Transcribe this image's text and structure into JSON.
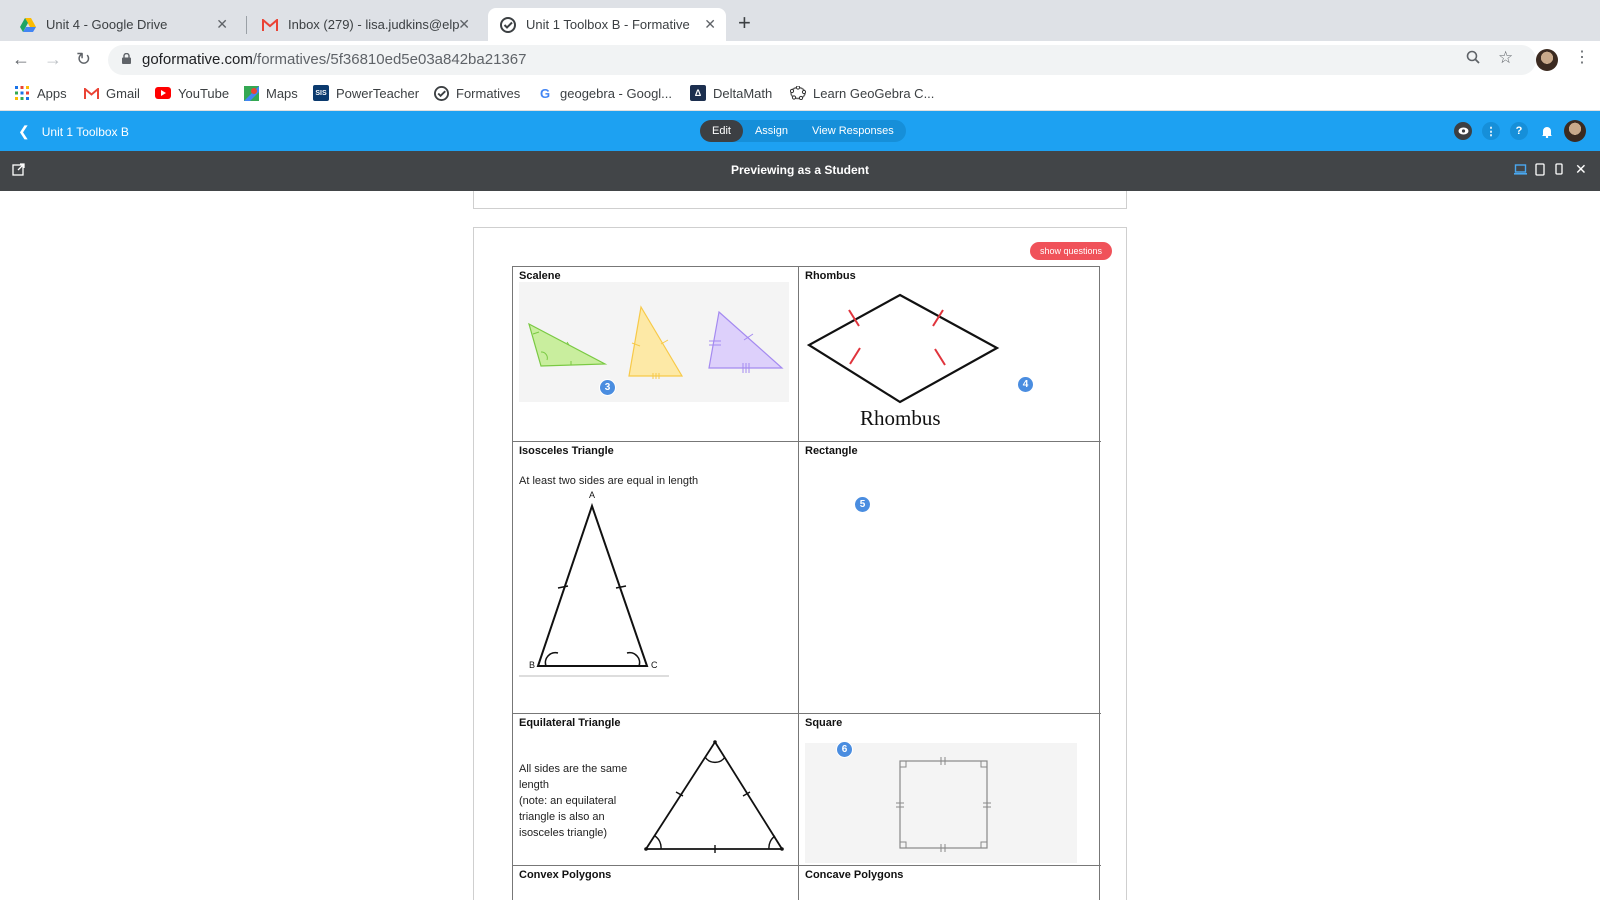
{
  "browser": {
    "tabs": [
      {
        "title": "Unit 4 - Google Drive",
        "icon": "google-drive-icon"
      },
      {
        "title": "Inbox (279) - lisa.judkins@elps",
        "icon": "gmail-icon"
      },
      {
        "title": "Unit 1 Toolbox B - Formative",
        "icon": "formative-icon",
        "active": true
      }
    ],
    "url_host": "goformative.com",
    "url_path": "/formatives/5f36810ed5e03a842ba21367",
    "bookmarks": [
      {
        "label": "Apps",
        "icon": "apps-grid-icon"
      },
      {
        "label": "Gmail",
        "icon": "gmail-icon"
      },
      {
        "label": "YouTube",
        "icon": "youtube-icon"
      },
      {
        "label": "Maps",
        "icon": "maps-icon"
      },
      {
        "label": "PowerTeacher",
        "icon": "sis-icon"
      },
      {
        "label": "Formatives",
        "icon": "formative-icon"
      },
      {
        "label": "geogebra - Googl...",
        "icon": "google-icon"
      },
      {
        "label": "DeltaMath",
        "icon": "deltamath-icon"
      },
      {
        "label": "Learn GeoGebra C...",
        "icon": "geogebra-icon"
      }
    ]
  },
  "formative": {
    "back_label": "Unit  1 Toolbox B",
    "segments": [
      "Edit",
      "Assign",
      "View Responses"
    ],
    "preview_title": "Previewing as a Student",
    "show_questions": "show questions"
  },
  "table": {
    "cells": {
      "scalene": {
        "title": "Scalene",
        "badge": "3"
      },
      "rhombus": {
        "title": "Rhombus",
        "badge": "4",
        "caption": "Rhombus"
      },
      "isosceles": {
        "title": "Isosceles Triangle",
        "text": "At least two sides are equal in length",
        "badge": ""
      },
      "rectangle": {
        "title": "Rectangle",
        "badge": "5"
      },
      "equilateral": {
        "title": "Equilateral Triangle",
        "text_lines": [
          "All sides are the same",
          "length",
          "(note:  an equilateral",
          "triangle is also an",
          "isosceles triangle)"
        ]
      },
      "square": {
        "title": "Square",
        "badge": "6"
      },
      "convex": {
        "title": "Convex Polygons"
      },
      "concave": {
        "title": "Concave Polygons"
      }
    },
    "vertex_labels": {
      "a": "A",
      "b": "B",
      "c": "C"
    }
  },
  "colors": {
    "header_blue": "#1da1f2",
    "preview_dark": "#424548",
    "badge_blue": "#4a8de0",
    "show_questions_red": "#f0525a"
  }
}
